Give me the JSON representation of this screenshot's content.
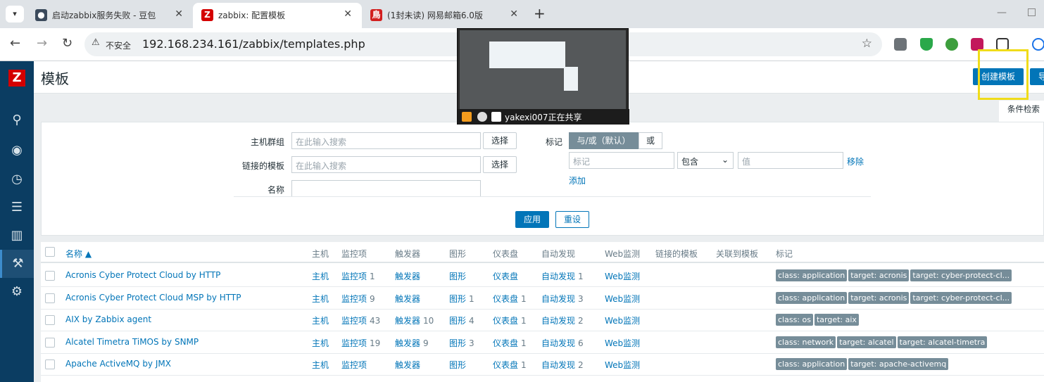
{
  "browser": {
    "tabs": [
      {
        "title": "启动zabbix服务失败 - 豆包",
        "close": "✕"
      },
      {
        "title": "zabbix: 配置模板",
        "close": "✕"
      },
      {
        "title": "(1封未读) 网易邮箱6.0版",
        "close": "✕"
      }
    ],
    "insecure_label": "不安全",
    "url": "192.168.234.161/zabbix/templates.php"
  },
  "share_overlay": {
    "presenter": "yakexi007正在共享"
  },
  "page": {
    "title": "模板",
    "create_button": "创建模板",
    "import_button": "导",
    "filter_tab": "条件检索"
  },
  "filter": {
    "host_group_label": "主机群组",
    "host_group_placeholder": "在此输入搜索",
    "linked_template_label": "链接的模板",
    "linked_template_placeholder": "在此输入搜索",
    "name_label": "名称",
    "name_value": "",
    "select_label": "选择",
    "tags_label": "标记",
    "and_or_label": "与/或（默认）",
    "or_label": "或",
    "tag_placeholder": "标记",
    "operator_value": "包含",
    "value_placeholder": "值",
    "remove_label": "移除",
    "add_label": "添加",
    "apply_label": "应用",
    "reset_label": "重设"
  },
  "table": {
    "headers": {
      "name": "名称 ▲",
      "hosts": "主机",
      "items": "监控项",
      "triggers": "触发器",
      "graphs": "图形",
      "dashboards": "仪表盘",
      "discovery": "自动发现",
      "web": "Web监测",
      "linked_templates": "链接的模板",
      "linked_to": "关联到模板",
      "tags": "标记"
    },
    "rows": [
      {
        "name": "Acronis Cyber Protect Cloud by HTTP",
        "hosts": "主机",
        "items": "监控项",
        "items_count": "1",
        "triggers": "触发器",
        "triggers_count": "",
        "graphs": "图形",
        "graphs_count": "",
        "dashboards": "仪表盘",
        "dashboards_count": "",
        "discovery": "自动发现",
        "discovery_count": "1",
        "web": "Web监测",
        "tags": [
          "class: application",
          "target: acronis",
          "target: cyber-protect-cl..."
        ]
      },
      {
        "name": "Acronis Cyber Protect Cloud MSP by HTTP",
        "hosts": "主机",
        "items": "监控项",
        "items_count": "9",
        "triggers": "触发器",
        "triggers_count": "",
        "graphs": "图形",
        "graphs_count": "1",
        "dashboards": "仪表盘",
        "dashboards_count": "1",
        "discovery": "自动发现",
        "discovery_count": "3",
        "web": "Web监测",
        "tags": [
          "class: application",
          "target: acronis",
          "target: cyber-protect-cl..."
        ]
      },
      {
        "name": "AIX by Zabbix agent",
        "hosts": "主机",
        "items": "监控项",
        "items_count": "43",
        "triggers": "触发器",
        "triggers_count": "10",
        "graphs": "图形",
        "graphs_count": "4",
        "dashboards": "仪表盘",
        "dashboards_count": "1",
        "discovery": "自动发现",
        "discovery_count": "2",
        "web": "Web监测",
        "tags": [
          "class: os",
          "target: aix"
        ]
      },
      {
        "name": "Alcatel Timetra TiMOS by SNMP",
        "hosts": "主机",
        "items": "监控项",
        "items_count": "19",
        "triggers": "触发器",
        "triggers_count": "9",
        "graphs": "图形",
        "graphs_count": "3",
        "dashboards": "仪表盘",
        "dashboards_count": "1",
        "discovery": "自动发现",
        "discovery_count": "6",
        "web": "Web监测",
        "tags": [
          "class: network",
          "target: alcatel",
          "target: alcatel-timetra"
        ]
      },
      {
        "name": "Apache ActiveMQ by JMX",
        "hosts": "主机",
        "items": "监控项",
        "items_count": "",
        "triggers": "触发器",
        "triggers_count": "",
        "graphs": "图形",
        "graphs_count": "",
        "dashboards": "仪表盘",
        "dashboards_count": "1",
        "discovery": "自动发现",
        "discovery_count": "2",
        "web": "Web监测",
        "tags": [
          "class: application",
          "target: apache-activemq"
        ]
      }
    ]
  }
}
